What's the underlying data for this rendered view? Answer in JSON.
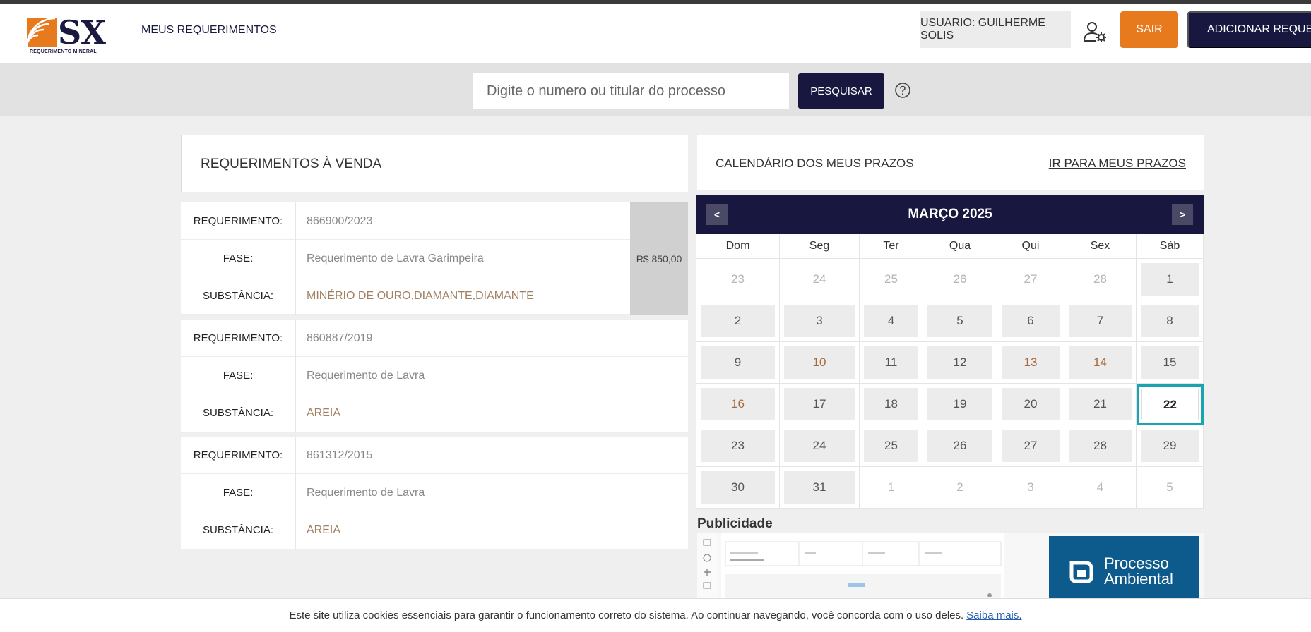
{
  "header": {
    "logo_text": "SX",
    "logo_subtitle": "REQUERIMENTO MINERAL",
    "nav_link": "MEUS REQUERIMENTOS",
    "user_label": "USUARIO: GUILHERME SOLIS",
    "logout_label": "SAIR",
    "add_label": "ADICIONAR REQUERIMENTO",
    "colors": {
      "accent": "#e87a1e",
      "navy": "#17173f"
    }
  },
  "search": {
    "placeholder": "Digite o numero ou titular do processo",
    "button_label": "PESQUISAR"
  },
  "requests": {
    "title": "REQUERIMENTOS À VENDA",
    "labels": {
      "req": "REQUERIMENTO:",
      "fase": "FASE:",
      "sub": "SUBSTÂNCIA:"
    },
    "items": [
      {
        "req": "866900/2023",
        "fase": "Requerimento de Lavra Garimpeira",
        "sub": "MINÉRIO DE OURO,DIAMANTE,DIAMANTE",
        "price": "R$ 850,00"
      },
      {
        "req": "860887/2019",
        "fase": "Requerimento de Lavra",
        "sub": "AREIA",
        "price": ""
      },
      {
        "req": "861312/2015",
        "fase": "Requerimento de Lavra",
        "sub": "AREIA",
        "price": ""
      }
    ]
  },
  "calendar": {
    "title": "CALENDÁRIO DOS MEUS PRAZOS",
    "link": "IR PARA MEUS PRAZOS",
    "month": "MARÇO 2025",
    "prev": "<",
    "next": ">",
    "weekdays": [
      "Dom",
      "Seg",
      "Ter",
      "Qua",
      "Qui",
      "Sex",
      "Sáb"
    ],
    "weeks": [
      [
        {
          "d": "23",
          "t": "other"
        },
        {
          "d": "24",
          "t": "other"
        },
        {
          "d": "25",
          "t": "other"
        },
        {
          "d": "26",
          "t": "other"
        },
        {
          "d": "27",
          "t": "other"
        },
        {
          "d": "28",
          "t": "other"
        },
        {
          "d": "1",
          "t": "cur"
        }
      ],
      [
        {
          "d": "2",
          "t": "cur"
        },
        {
          "d": "3",
          "t": "cur"
        },
        {
          "d": "4",
          "t": "cur"
        },
        {
          "d": "5",
          "t": "cur"
        },
        {
          "d": "6",
          "t": "cur"
        },
        {
          "d": "7",
          "t": "cur"
        },
        {
          "d": "8",
          "t": "cur"
        }
      ],
      [
        {
          "d": "9",
          "t": "cur"
        },
        {
          "d": "10",
          "t": "hl"
        },
        {
          "d": "11",
          "t": "cur"
        },
        {
          "d": "12",
          "t": "cur"
        },
        {
          "d": "13",
          "t": "hl"
        },
        {
          "d": "14",
          "t": "hl"
        },
        {
          "d": "15",
          "t": "cur"
        }
      ],
      [
        {
          "d": "16",
          "t": "hl"
        },
        {
          "d": "17",
          "t": "cur"
        },
        {
          "d": "18",
          "t": "cur"
        },
        {
          "d": "19",
          "t": "cur"
        },
        {
          "d": "20",
          "t": "cur"
        },
        {
          "d": "21",
          "t": "cur"
        },
        {
          "d": "22",
          "t": "today"
        }
      ],
      [
        {
          "d": "23",
          "t": "cur"
        },
        {
          "d": "24",
          "t": "cur"
        },
        {
          "d": "25",
          "t": "cur"
        },
        {
          "d": "26",
          "t": "cur"
        },
        {
          "d": "27",
          "t": "cur"
        },
        {
          "d": "28",
          "t": "cur"
        },
        {
          "d": "29",
          "t": "cur"
        }
      ],
      [
        {
          "d": "30",
          "t": "cur"
        },
        {
          "d": "31",
          "t": "cur"
        },
        {
          "d": "1",
          "t": "other"
        },
        {
          "d": "2",
          "t": "other"
        },
        {
          "d": "3",
          "t": "other"
        },
        {
          "d": "4",
          "t": "other"
        },
        {
          "d": "5",
          "t": "other"
        }
      ]
    ]
  },
  "ad": {
    "title": "Publicidade",
    "brand_line1": "Processo",
    "brand_line2": "Ambiental"
  },
  "cookie": {
    "text": "Este site utiliza cookies essenciais para garantir o funcionamento correto do sistema. Ao continuar navegando, você concorda com o uso deles.",
    "link": "Saiba mais."
  }
}
